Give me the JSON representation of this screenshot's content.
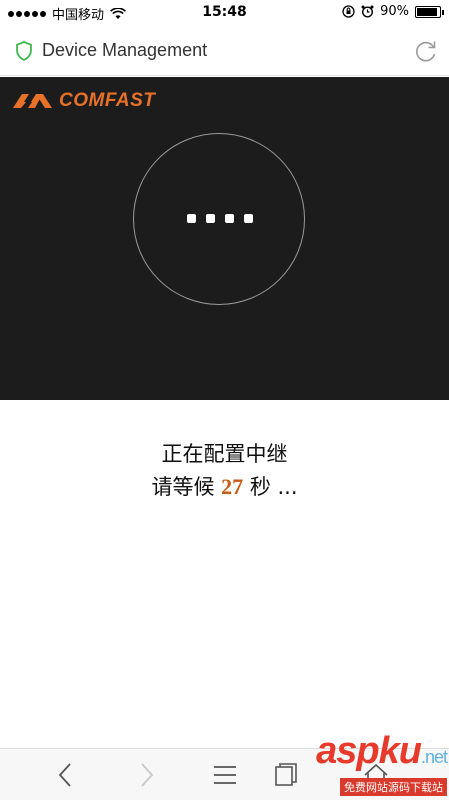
{
  "status_bar": {
    "carrier": "中国移动",
    "time": "15:48",
    "battery": "90%"
  },
  "nav": {
    "title": "Device Management"
  },
  "banner": {
    "logo_text": "COMFAST",
    "accent_color": "#e8712a"
  },
  "message": {
    "line1": "正在配置中继",
    "line2_prefix": "请等候",
    "countdown": "27",
    "line2_suffix": "秒 ..."
  },
  "toolbar": {
    "icons": [
      "back-icon",
      "forward-icon",
      "menu-icon",
      "tabs-icon",
      "home-icon"
    ]
  },
  "watermark": {
    "brand": "aspku",
    "domain": ".net",
    "tagline": "免费网站源码下载站"
  }
}
